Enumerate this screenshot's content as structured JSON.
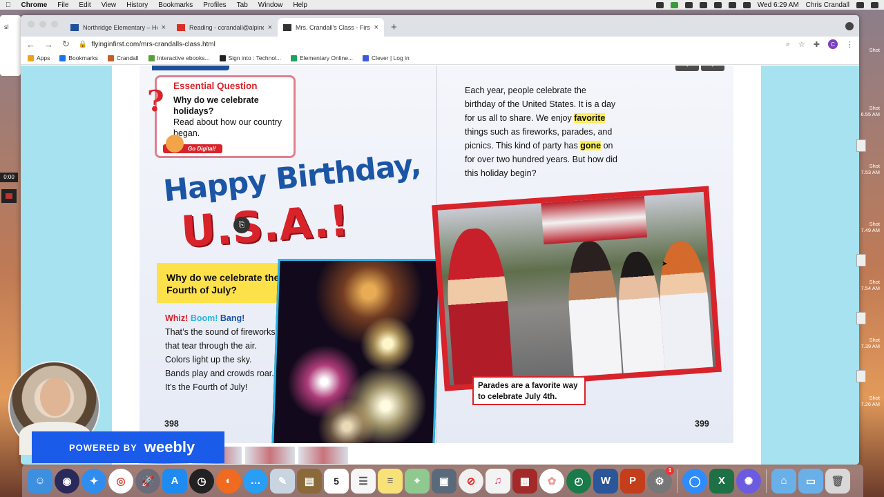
{
  "menubar": {
    "app": "Chrome",
    "items": [
      "File",
      "Edit",
      "View",
      "History",
      "Bookmarks",
      "Profiles",
      "Tab",
      "Window",
      "Help"
    ],
    "clock": "Wed 6:29 AM",
    "user": "Chris Crandall"
  },
  "tabs": [
    {
      "title": "Northridge Elementary – Home",
      "favicon": "school-icon",
      "color": "#1f4e9a"
    },
    {
      "title": "Reading - ccrandall@alpinedis",
      "favicon": "gmail-icon",
      "color": "#d93025"
    },
    {
      "title": "Mrs. Crandall's Class - First G",
      "favicon": "weebly-icon",
      "color": "#333333"
    }
  ],
  "toolbar": {
    "url": "flyinginfirst.com/mrs-crandalls-class.html",
    "profile_initial": "C"
  },
  "bookmarks": [
    {
      "label": "Apps",
      "color": "#e8a31f"
    },
    {
      "label": "Bookmarks",
      "color": "#1a73e8"
    },
    {
      "label": "Crandall",
      "color": "#c45e2a"
    },
    {
      "label": "Interactive ebooks...",
      "color": "#5a9e3a"
    },
    {
      "label": "Sign into : Technol...",
      "color": "#222222"
    },
    {
      "label": "Elementary Online...",
      "color": "#1aa260"
    },
    {
      "label": "Clever | Log in",
      "color": "#3b5bdb"
    }
  ],
  "book": {
    "essential_heading": "Essential Question",
    "essential_q": "Why do we celebrate holidays?",
    "essential_read": "Read about how our country began.",
    "go_digital": "Go Digital!",
    "title_line1": "Happy Birthday,",
    "title_line2": "U.S.A.!",
    "why_heading": "Why do we celebrate the Fourth of July?",
    "whiz": "Whiz!",
    "boom": "Boom!",
    "bang": "Bang!",
    "body_left": "That’s the sound of fireworks that tear through the air. Colors light up the sky. Bands play and crowds roar. It’s the Fourth of July!",
    "page_left": "398",
    "page_right": "399",
    "right_p1": "Each year, people celebrate the birthday of the United States. It is a day for us all to share. We enjoy",
    "right_hl1": "favorite",
    "right_p2": "things such as fireworks, parades, and picnics. This kind of party has",
    "right_hl2": "gone",
    "right_p3": "on for over two hundred years. But how did this holiday begin?",
    "caption": "Parades are a favorite way to celebrate July 4th."
  },
  "weebly": {
    "powered": "POWERED BY",
    "brand": "weebly"
  },
  "recorder": {
    "time": "0:00"
  },
  "desktop": {
    "left_edge": "sl",
    "screenshots": [
      {
        "line1": "Shot",
        "line2": "6.55 AM"
      },
      {
        "line1": "Shot",
        "line2": "7.53 AM"
      },
      {
        "line1": "Shot",
        "line2": "7.49 AM"
      },
      {
        "line1": "Shot",
        "line2": "7.54 AM"
      },
      {
        "line1": "Shot",
        "line2": "7.39 AM"
      },
      {
        "line1": "Shot",
        "line2": "7.26 AM"
      }
    ]
  },
  "dock": {
    "calendar_day": "5",
    "mail_badge": "1"
  }
}
